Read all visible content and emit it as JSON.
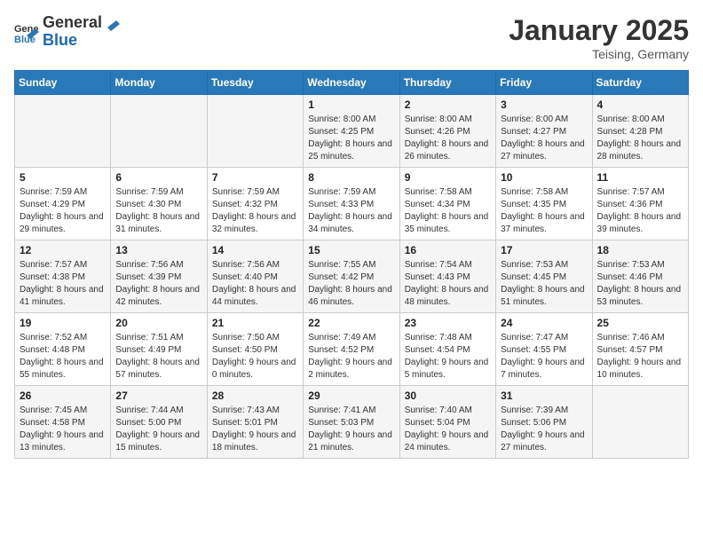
{
  "header": {
    "logo_general": "General",
    "logo_blue": "Blue",
    "month": "January 2025",
    "location": "Teising, Germany"
  },
  "weekdays": [
    "Sunday",
    "Monday",
    "Tuesday",
    "Wednesday",
    "Thursday",
    "Friday",
    "Saturday"
  ],
  "weeks": [
    [
      {
        "day": "",
        "sunrise": "",
        "sunset": "",
        "daylight": ""
      },
      {
        "day": "",
        "sunrise": "",
        "sunset": "",
        "daylight": ""
      },
      {
        "day": "",
        "sunrise": "",
        "sunset": "",
        "daylight": ""
      },
      {
        "day": "1",
        "sunrise": "Sunrise: 8:00 AM",
        "sunset": "Sunset: 4:25 PM",
        "daylight": "Daylight: 8 hours and 25 minutes."
      },
      {
        "day": "2",
        "sunrise": "Sunrise: 8:00 AM",
        "sunset": "Sunset: 4:26 PM",
        "daylight": "Daylight: 8 hours and 26 minutes."
      },
      {
        "day": "3",
        "sunrise": "Sunrise: 8:00 AM",
        "sunset": "Sunset: 4:27 PM",
        "daylight": "Daylight: 8 hours and 27 minutes."
      },
      {
        "day": "4",
        "sunrise": "Sunrise: 8:00 AM",
        "sunset": "Sunset: 4:28 PM",
        "daylight": "Daylight: 8 hours and 28 minutes."
      }
    ],
    [
      {
        "day": "5",
        "sunrise": "Sunrise: 7:59 AM",
        "sunset": "Sunset: 4:29 PM",
        "daylight": "Daylight: 8 hours and 29 minutes."
      },
      {
        "day": "6",
        "sunrise": "Sunrise: 7:59 AM",
        "sunset": "Sunset: 4:30 PM",
        "daylight": "Daylight: 8 hours and 31 minutes."
      },
      {
        "day": "7",
        "sunrise": "Sunrise: 7:59 AM",
        "sunset": "Sunset: 4:32 PM",
        "daylight": "Daylight: 8 hours and 32 minutes."
      },
      {
        "day": "8",
        "sunrise": "Sunrise: 7:59 AM",
        "sunset": "Sunset: 4:33 PM",
        "daylight": "Daylight: 8 hours and 34 minutes."
      },
      {
        "day": "9",
        "sunrise": "Sunrise: 7:58 AM",
        "sunset": "Sunset: 4:34 PM",
        "daylight": "Daylight: 8 hours and 35 minutes."
      },
      {
        "day": "10",
        "sunrise": "Sunrise: 7:58 AM",
        "sunset": "Sunset: 4:35 PM",
        "daylight": "Daylight: 8 hours and 37 minutes."
      },
      {
        "day": "11",
        "sunrise": "Sunrise: 7:57 AM",
        "sunset": "Sunset: 4:36 PM",
        "daylight": "Daylight: 8 hours and 39 minutes."
      }
    ],
    [
      {
        "day": "12",
        "sunrise": "Sunrise: 7:57 AM",
        "sunset": "Sunset: 4:38 PM",
        "daylight": "Daylight: 8 hours and 41 minutes."
      },
      {
        "day": "13",
        "sunrise": "Sunrise: 7:56 AM",
        "sunset": "Sunset: 4:39 PM",
        "daylight": "Daylight: 8 hours and 42 minutes."
      },
      {
        "day": "14",
        "sunrise": "Sunrise: 7:56 AM",
        "sunset": "Sunset: 4:40 PM",
        "daylight": "Daylight: 8 hours and 44 minutes."
      },
      {
        "day": "15",
        "sunrise": "Sunrise: 7:55 AM",
        "sunset": "Sunset: 4:42 PM",
        "daylight": "Daylight: 8 hours and 46 minutes."
      },
      {
        "day": "16",
        "sunrise": "Sunrise: 7:54 AM",
        "sunset": "Sunset: 4:43 PM",
        "daylight": "Daylight: 8 hours and 48 minutes."
      },
      {
        "day": "17",
        "sunrise": "Sunrise: 7:53 AM",
        "sunset": "Sunset: 4:45 PM",
        "daylight": "Daylight: 8 hours and 51 minutes."
      },
      {
        "day": "18",
        "sunrise": "Sunrise: 7:53 AM",
        "sunset": "Sunset: 4:46 PM",
        "daylight": "Daylight: 8 hours and 53 minutes."
      }
    ],
    [
      {
        "day": "19",
        "sunrise": "Sunrise: 7:52 AM",
        "sunset": "Sunset: 4:48 PM",
        "daylight": "Daylight: 8 hours and 55 minutes."
      },
      {
        "day": "20",
        "sunrise": "Sunrise: 7:51 AM",
        "sunset": "Sunset: 4:49 PM",
        "daylight": "Daylight: 8 hours and 57 minutes."
      },
      {
        "day": "21",
        "sunrise": "Sunrise: 7:50 AM",
        "sunset": "Sunset: 4:50 PM",
        "daylight": "Daylight: 9 hours and 0 minutes."
      },
      {
        "day": "22",
        "sunrise": "Sunrise: 7:49 AM",
        "sunset": "Sunset: 4:52 PM",
        "daylight": "Daylight: 9 hours and 2 minutes."
      },
      {
        "day": "23",
        "sunrise": "Sunrise: 7:48 AM",
        "sunset": "Sunset: 4:54 PM",
        "daylight": "Daylight: 9 hours and 5 minutes."
      },
      {
        "day": "24",
        "sunrise": "Sunrise: 7:47 AM",
        "sunset": "Sunset: 4:55 PM",
        "daylight": "Daylight: 9 hours and 7 minutes."
      },
      {
        "day": "25",
        "sunrise": "Sunrise: 7:46 AM",
        "sunset": "Sunset: 4:57 PM",
        "daylight": "Daylight: 9 hours and 10 minutes."
      }
    ],
    [
      {
        "day": "26",
        "sunrise": "Sunrise: 7:45 AM",
        "sunset": "Sunset: 4:58 PM",
        "daylight": "Daylight: 9 hours and 13 minutes."
      },
      {
        "day": "27",
        "sunrise": "Sunrise: 7:44 AM",
        "sunset": "Sunset: 5:00 PM",
        "daylight": "Daylight: 9 hours and 15 minutes."
      },
      {
        "day": "28",
        "sunrise": "Sunrise: 7:43 AM",
        "sunset": "Sunset: 5:01 PM",
        "daylight": "Daylight: 9 hours and 18 minutes."
      },
      {
        "day": "29",
        "sunrise": "Sunrise: 7:41 AM",
        "sunset": "Sunset: 5:03 PM",
        "daylight": "Daylight: 9 hours and 21 minutes."
      },
      {
        "day": "30",
        "sunrise": "Sunrise: 7:40 AM",
        "sunset": "Sunset: 5:04 PM",
        "daylight": "Daylight: 9 hours and 24 minutes."
      },
      {
        "day": "31",
        "sunrise": "Sunrise: 7:39 AM",
        "sunset": "Sunset: 5:06 PM",
        "daylight": "Daylight: 9 hours and 27 minutes."
      },
      {
        "day": "",
        "sunrise": "",
        "sunset": "",
        "daylight": ""
      }
    ]
  ]
}
